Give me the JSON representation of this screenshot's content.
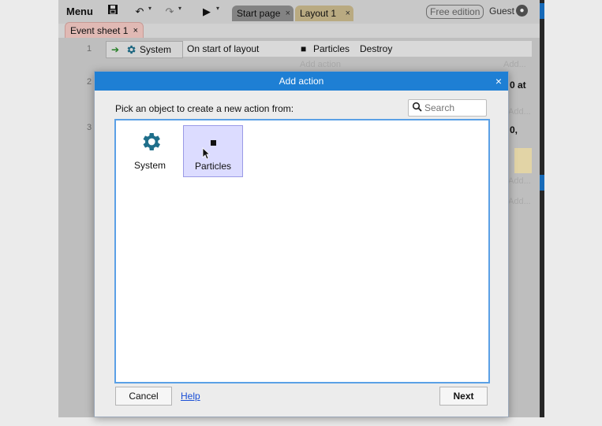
{
  "toolbar": {
    "menu_label": "Menu",
    "tabs": [
      {
        "label": "Start page",
        "close": "×"
      },
      {
        "label": "Layout 1",
        "close": "×"
      }
    ],
    "edition_badge": "Free edition",
    "user_label": "Guest"
  },
  "event_sheet": {
    "tab_label": "Event sheet 1",
    "tab_close": "×",
    "events": [
      {
        "number": "1",
        "condition_object": "System",
        "condition": "On start of layout",
        "action_object": "Particles",
        "action": "Destroy",
        "add_action": "Add action"
      },
      {
        "number": "2"
      },
      {
        "number": "3"
      }
    ],
    "ghost_add_labels": [
      "Add...",
      "Add...",
      "Add...",
      "Add..."
    ],
    "right_fragments": [
      "0 at",
      "0,"
    ]
  },
  "dialog": {
    "title": "Add action",
    "close": "×",
    "prompt": "Pick an object to create a new action from:",
    "search_placeholder": "Search",
    "objects": [
      {
        "label": "System",
        "icon": "gear-icon",
        "selected": false
      },
      {
        "label": "Particles",
        "icon": "particles-icon",
        "selected": true
      }
    ],
    "cancel_label": "Cancel",
    "help_label": "Help",
    "next_label": "Next"
  },
  "colors": {
    "title_bar": "#1e7fd4",
    "list_border": "#5aa0e6",
    "selected_bg": "#dcdcff",
    "gear": "#1f6f8b",
    "link": "#1a4fd6"
  }
}
